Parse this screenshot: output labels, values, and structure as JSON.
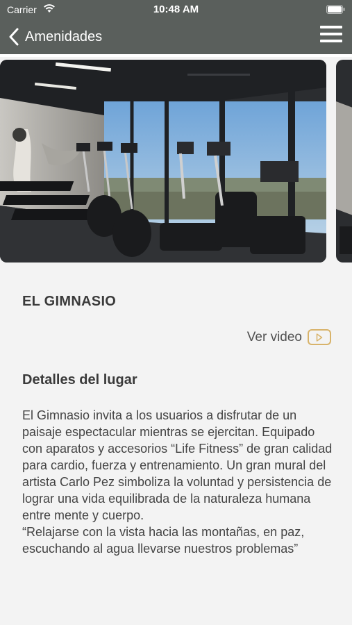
{
  "status_bar": {
    "carrier": "Carrier",
    "time": "10:48 AM"
  },
  "nav": {
    "back_label": "Amenidades",
    "back_icon": "chevron-left-icon",
    "menu_icon": "hamburger-menu-icon"
  },
  "amenity": {
    "title": "EL GIMNASIO",
    "video_label": "Ver video",
    "details_heading": "Detalles del lugar",
    "description": [
      "El Gimnasio invita a los usuarios a disfrutar de un paisaje espectacular mientras se ejercitan. Equipado con aparatos y accesorios “Life Fitness” de gran calidad para cardio, fuerza y entrenamiento. Un gran mural del artista Carlo Pez simboliza la voluntad y persistencia de lograr una vida equilibrada de la naturaleza humana entre mente y cuerpo.",
      "“Relajarse con la vista hacia las montañas, en paz, escuchando al agua llevarse nuestros problemas”"
    ]
  },
  "colors": {
    "header": "#5a5f5c",
    "accent": "#d8b36a",
    "background": "#f3f3f3"
  }
}
